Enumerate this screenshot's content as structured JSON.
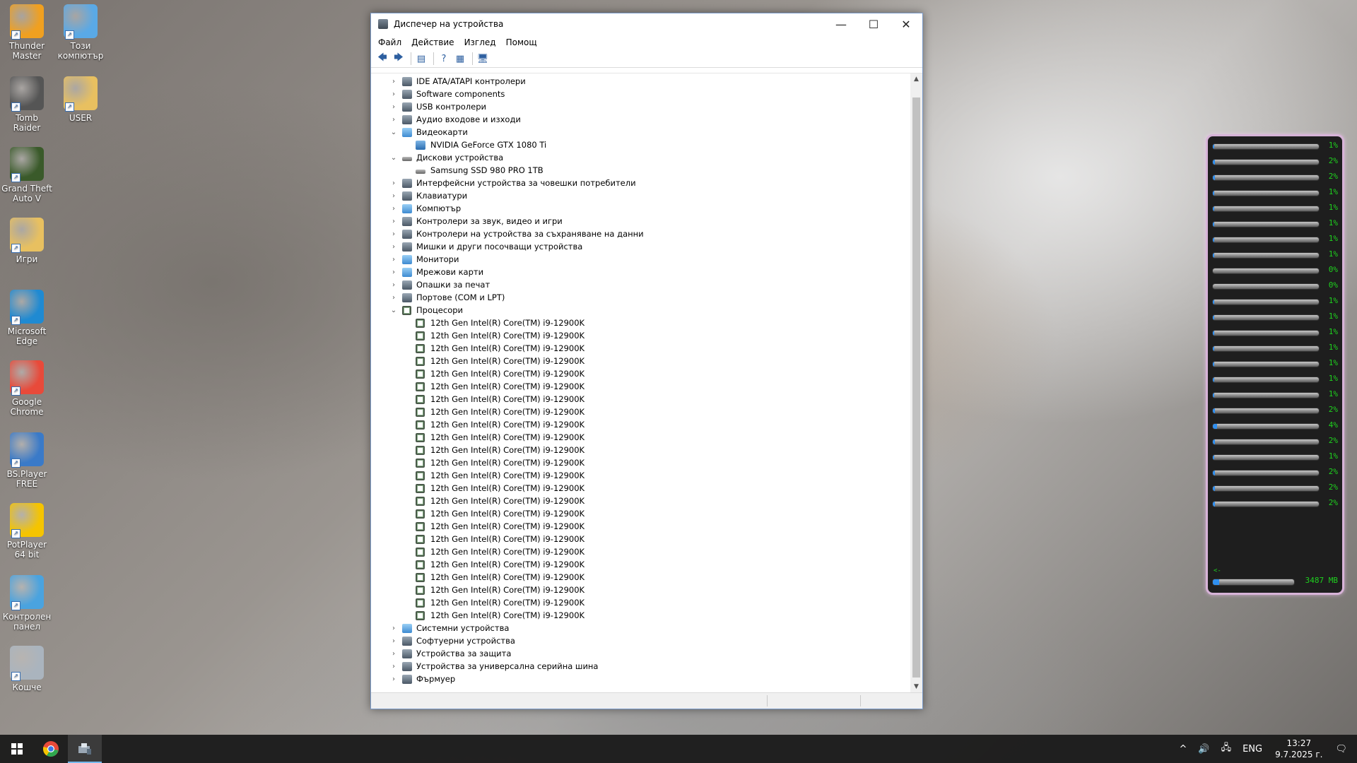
{
  "desktop": {
    "icons": [
      {
        "label": "Thunder Master",
        "color": "#f0a020"
      },
      {
        "label": "Този компютър",
        "color": "#5aa9e6"
      },
      {
        "label": "Tomb Raider",
        "color": "#555555"
      },
      {
        "label": "USER",
        "color": "#e8c060"
      },
      {
        "label": "Grand Theft Auto V",
        "color": "#3a5a2a"
      },
      {
        "label": "Игри",
        "color": "#e8c060"
      },
      {
        "label": "Microsoft Edge",
        "color": "#1f8ad2"
      },
      {
        "label": "Google Chrome",
        "color": "#e84a3a"
      },
      {
        "label": "BS.Player FREE",
        "color": "#3a7ac8"
      },
      {
        "label": "PotPlayer 64 bit",
        "color": "#f5c400"
      },
      {
        "label": "Контролен панел",
        "color": "#4aa3df"
      },
      {
        "label": "Кошче",
        "color": "#aab4be"
      }
    ]
  },
  "window": {
    "title": "Диспечер на устройства",
    "controls": {
      "minimize": "—",
      "maximize": "☐",
      "close": "✕"
    },
    "menu": [
      "Файл",
      "Действие",
      "Изглед",
      "Помощ"
    ],
    "toolbar": {
      "back": "🡄",
      "forward": "🡆",
      "properties": "▤",
      "help": "?",
      "view": "▦",
      "monitor": "🖥"
    }
  },
  "tree": {
    "categories_top": [
      {
        "label": "IDE ATA/ATAPI контролери",
        "expanded": false
      },
      {
        "label": "Software components",
        "expanded": false
      },
      {
        "label": "USB контролери",
        "expanded": false
      },
      {
        "label": "Аудио входове и изходи",
        "expanded": false
      }
    ],
    "video": {
      "label": "Видеокарти",
      "children": [
        "NVIDIA GeForce GTX 1080 Ti"
      ]
    },
    "disks": {
      "label": "Дискови устройства",
      "children": [
        "Samsung SSD 980 PRO 1TB"
      ]
    },
    "categories_mid": [
      "Интерфейсни устройства за човешки потребители",
      "Клавиатури",
      "Компютър",
      "Контролери за звук, видео и игри",
      "Контролери на устройства за съхраняване на данни",
      "Мишки и други посочващи устройства",
      "Монитори",
      "Мрежови карти",
      "Опашки за печат",
      "Портове (COM и LPT)"
    ],
    "processors": {
      "label": "Процесори",
      "child_label": "12th Gen Intel(R) Core(TM) i9-12900K",
      "count": 24
    },
    "categories_bottom": [
      "Системни устройства",
      "Софтуерни устройства",
      "Устройства за защита",
      "Устройства за универсална серийна шина",
      "Фърмуер"
    ],
    "chevron_collapsed": "›",
    "chevron_expanded": "⌄"
  },
  "cpu_widget": {
    "cores": [
      1,
      2,
      2,
      1,
      1,
      1,
      1,
      1,
      0,
      0,
      1,
      1,
      1,
      1,
      1,
      1,
      1,
      2,
      4,
      2,
      1,
      2,
      2,
      2
    ],
    "memory_label": "3487 MB",
    "memory_fraction": 0.08,
    "memory_arrow": "<-"
  },
  "taskbar": {
    "start_icon": "windows-logo",
    "apps": [
      {
        "name": "chrome",
        "active": false
      },
      {
        "name": "device-manager",
        "active": true
      }
    ],
    "tray": {
      "chevron": "^",
      "volume": "🔊",
      "network": "🖧",
      "language": "ENG"
    },
    "time": "13:27",
    "date": "9.7.2025 г.",
    "notification": "🗨"
  }
}
